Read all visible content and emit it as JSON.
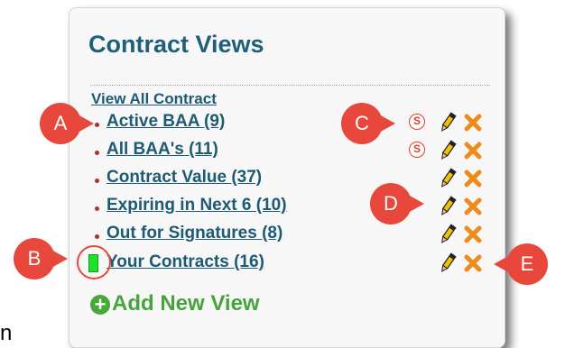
{
  "panel": {
    "title": "Contract Views",
    "view_all": "View All Contract",
    "add_view_label": "Add New View"
  },
  "rows": [
    {
      "label": "Active BAA (9)",
      "share_icon": "S"
    },
    {
      "label": "All BAA's (11)",
      "share_icon": "S"
    },
    {
      "label": "Contract Value (37)"
    },
    {
      "label": "Expiring in Next 6 (10)"
    },
    {
      "label": "Out for Signatures (8)"
    },
    {
      "label": "Your Contracts (16)",
      "default_marker": true
    }
  ],
  "callouts": {
    "a": "A",
    "b": "B",
    "c": "C",
    "d": "D",
    "e": "E"
  },
  "stray_text": "n",
  "colors": {
    "title": "#1f5f7a",
    "link": "#1d5a73",
    "bullet": "#b03030",
    "callout": "#e8473b",
    "add_green": "#47a33b",
    "delete_orange": "#f08a1c"
  },
  "icons": {
    "share": "circle-s-icon",
    "edit": "pencil-icon",
    "delete": "orange-x-icon",
    "add": "plus-circle-icon",
    "default": "green-default-marker"
  }
}
